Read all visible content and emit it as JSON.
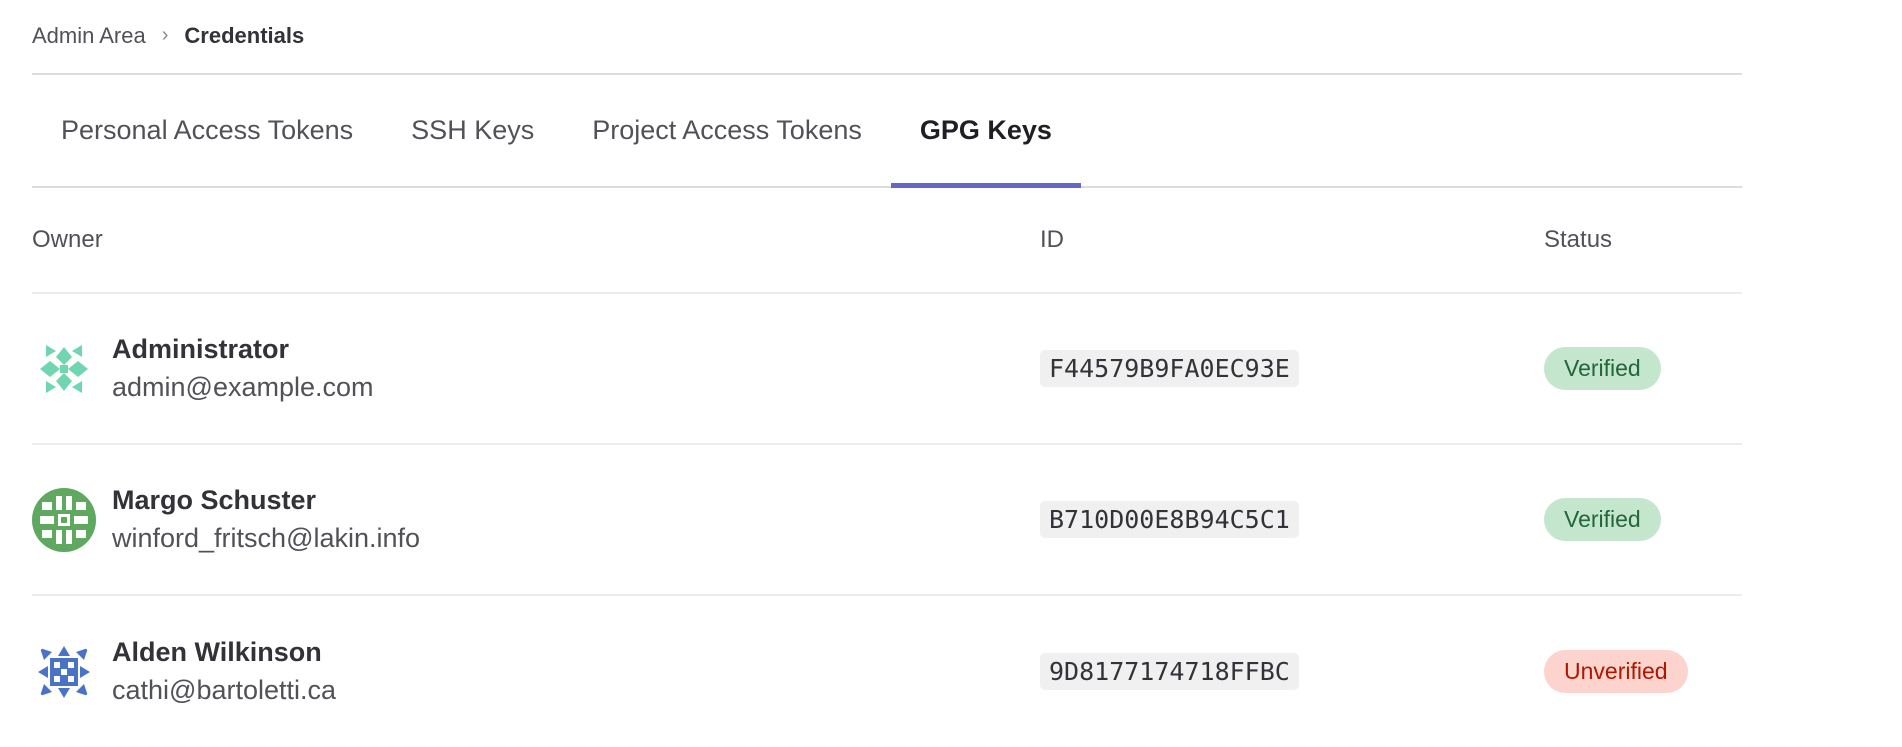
{
  "breadcrumb": {
    "parent": "Admin Area",
    "separator": "›",
    "current": "Credentials"
  },
  "tabs": [
    {
      "label": "Personal Access Tokens",
      "active": false
    },
    {
      "label": "SSH Keys",
      "active": false
    },
    {
      "label": "Project Access Tokens",
      "active": false
    },
    {
      "label": "GPG Keys",
      "active": true
    }
  ],
  "table": {
    "headers": {
      "owner": "Owner",
      "id": "ID",
      "status": "Status"
    },
    "rows": [
      {
        "name": "Administrator",
        "email": "admin@example.com",
        "key_id": "F44579B9FA0EC93E",
        "status": "Verified",
        "status_type": "verified",
        "avatar_icon": "identicon-teal-icon"
      },
      {
        "name": "Margo Schuster",
        "email": "winford_fritsch@lakin.info",
        "key_id": "B710D00E8B94C5C1",
        "status": "Verified",
        "status_type": "verified",
        "avatar_icon": "identicon-green-icon"
      },
      {
        "name": "Alden Wilkinson",
        "email": "cathi@bartoletti.ca",
        "key_id": "9D8177174718FFBC",
        "status": "Unverified",
        "status_type": "unverified",
        "avatar_icon": "identicon-blue-icon"
      }
    ]
  },
  "colors": {
    "tab_active_underline": "#6666c4",
    "verified_bg": "#c3e6cd",
    "verified_text": "#24663b",
    "unverified_bg": "#fdd4cd",
    "unverified_text": "#ae1800"
  }
}
